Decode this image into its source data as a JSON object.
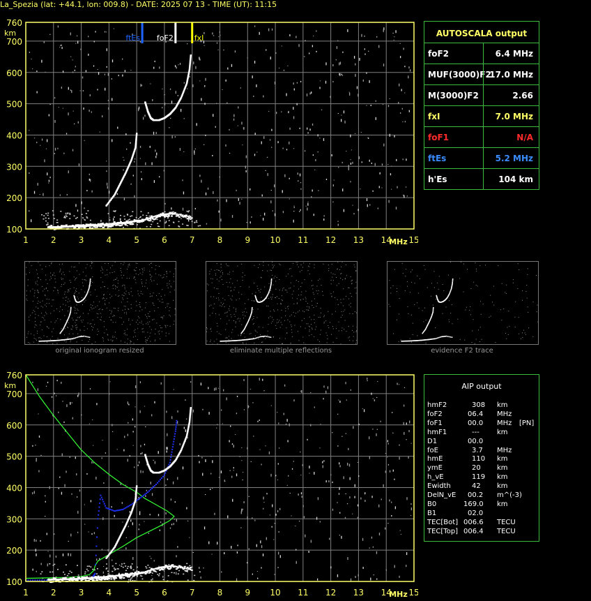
{
  "header": {
    "text": "La_Spezia (lat: +44.1, lon: 009.8) - DATE: 2025 07 13 - TIME (UT): 11:15"
  },
  "ionogram_top": {
    "y_unit": "km",
    "x_unit": "MHz",
    "x_ticks": [
      "1",
      "2",
      "3",
      "4",
      "5",
      "6",
      "7",
      "8",
      "9",
      "10",
      "11",
      "12",
      "13",
      "14",
      "15"
    ],
    "y_ticks": [
      "100",
      "200",
      "300",
      "400",
      "500",
      "600",
      "700",
      "760"
    ],
    "markers": {
      "ftEs": "ftEs",
      "foF2": "foF2",
      "fxI": "fxI"
    }
  },
  "ionogram_bottom": {
    "y_unit": "km",
    "x_unit": "MHz",
    "x_ticks": [
      "1",
      "2",
      "3",
      "4",
      "5",
      "6",
      "7",
      "8",
      "9",
      "10",
      "11",
      "12",
      "13",
      "14",
      "15"
    ],
    "y_ticks": [
      "100",
      "200",
      "300",
      "400",
      "500",
      "600",
      "700",
      "760"
    ]
  },
  "autoscala": {
    "title": "AUTOSCALA output",
    "rows": [
      {
        "label": "foF2",
        "value": "6.4 MHz",
        "color": "#ffffff"
      },
      {
        "label": "MUF(3000)F2",
        "value": "17.0 MHz",
        "color": "#ffffff"
      },
      {
        "label": "M(3000)F2",
        "value": "2.66",
        "color": "#ffffff"
      },
      {
        "label": "fxI",
        "value": "7.0 MHz",
        "color": "#ffff66"
      },
      {
        "label": "foF1",
        "value": "N/A",
        "color": "#ff2a2a"
      },
      {
        "label": "ftEs",
        "value": "5.2 MHz",
        "color": "#3a8cff"
      },
      {
        "label": "h'Es",
        "value": "104    km",
        "color": "#ffffff"
      }
    ]
  },
  "thumbnails": [
    {
      "caption": "original ionogram resized"
    },
    {
      "caption": "eliminate multiple reflections"
    },
    {
      "caption": "evidence F2 trace"
    }
  ],
  "aip": {
    "title": "AIP output",
    "rows": [
      {
        "param": "hmF2",
        "value": "308",
        "unit": "km",
        "extra": ""
      },
      {
        "param": "foF2",
        "value": "06.4",
        "unit": "MHz",
        "extra": ""
      },
      {
        "param": "foF1",
        "value": "00.0",
        "unit": "MHz",
        "extra": "[PN]"
      },
      {
        "param": "hmF1",
        "value": "---",
        "unit": "km",
        "extra": ""
      },
      {
        "param": "D1",
        "value": "00.0",
        "unit": "",
        "extra": ""
      },
      {
        "param": "foE",
        "value": "3.7",
        "unit": "MHz",
        "extra": ""
      },
      {
        "param": "hmE",
        "value": "110",
        "unit": "km",
        "extra": ""
      },
      {
        "param": "ymE",
        "value": "20",
        "unit": "km",
        "extra": ""
      },
      {
        "param": "h_vE",
        "value": "119",
        "unit": "km",
        "extra": ""
      },
      {
        "param": "Ewidth",
        "value": "42",
        "unit": "km",
        "extra": ""
      },
      {
        "param": "DelN_vE",
        "value": "00.2",
        "unit": "m^(-3)",
        "extra": ""
      },
      {
        "param": "B0",
        "value": "169.0",
        "unit": "km",
        "extra": ""
      },
      {
        "param": "B1",
        "value": "02.0",
        "unit": "",
        "extra": ""
      },
      {
        "param": "TEC[Bot]",
        "value": "006.6",
        "unit": "TECU",
        "extra": ""
      },
      {
        "param": "TEC[Top]",
        "value": "006.4",
        "unit": "TECU",
        "extra": ""
      }
    ]
  },
  "chart_data": [
    {
      "type": "scatter",
      "xlim": [
        1,
        15
      ],
      "ylim": [
        100,
        760
      ],
      "xlabel": "MHz",
      "ylabel": "km",
      "grid": true,
      "colors": {
        "axis": "#ffff66",
        "grid": "#808080",
        "trace": "#ffffff",
        "ftEs": "#1e64ff",
        "foF2": "#ffffff",
        "fxI": "#ffff00"
      },
      "vertical_markers": [
        {
          "name": "ftEs",
          "x": 5.2
        },
        {
          "name": "foF2",
          "x": 6.4
        },
        {
          "name": "fxI",
          "x": 7.0
        }
      ],
      "series": [
        {
          "points": [
            [
              1.8,
              106
            ],
            [
              2.2,
              107
            ],
            [
              2.6,
              108
            ],
            [
              3.0,
              110
            ],
            [
              3.3,
              111
            ],
            [
              3.6,
              113
            ],
            [
              3.9,
              115
            ],
            [
              4.2,
              118
            ],
            [
              4.5,
              120
            ],
            [
              4.8,
              124
            ],
            [
              5.2,
              128
            ],
            [
              5.8,
              145
            ],
            [
              6.3,
              150
            ],
            [
              7.0,
              138
            ]
          ]
        },
        {
          "points": [
            [
              3.9,
              175
            ],
            [
              4.2,
              210
            ],
            [
              4.4,
              245
            ],
            [
              4.6,
              280
            ],
            [
              4.8,
              320
            ],
            [
              4.95,
              360
            ],
            [
              5.0,
              410
            ]
          ]
        },
        {
          "points": [
            [
              5.3,
              505
            ],
            [
              5.4,
              475
            ],
            [
              5.5,
              455
            ],
            [
              5.6,
              448
            ],
            [
              5.8,
              448
            ],
            [
              6.0,
              455
            ],
            [
              6.2,
              468
            ],
            [
              6.4,
              488
            ],
            [
              6.6,
              520
            ],
            [
              6.8,
              565
            ],
            [
              6.9,
              610
            ],
            [
              6.95,
              660
            ]
          ]
        }
      ]
    },
    {
      "type": "line",
      "xlim": [
        1,
        15
      ],
      "ylim": [
        100,
        760
      ],
      "xlabel": "MHz",
      "ylabel": "km",
      "grid": true,
      "colors": {
        "axis": "#ffff66",
        "grid": "#808080",
        "profile": "#33ff33",
        "true_height": "#1e32ff",
        "trace": "#ffffff"
      },
      "series": [
        {
          "points": [
            [
              1.0,
              760
            ],
            [
              1.5,
              690
            ],
            [
              2.0,
              630
            ],
            [
              2.5,
              575
            ],
            [
              3.0,
              520
            ],
            [
              3.5,
              478
            ],
            [
              4.0,
              442
            ],
            [
              4.5,
              410
            ],
            [
              5.0,
              385
            ],
            [
              5.3,
              365
            ],
            [
              5.6,
              350
            ],
            [
              5.9,
              335
            ],
            [
              6.1,
              325
            ],
            [
              6.25,
              315
            ],
            [
              6.35,
              308
            ],
            [
              6.2,
              295
            ],
            [
              5.9,
              280
            ],
            [
              5.5,
              262
            ],
            [
              5.0,
              240
            ],
            [
              4.5,
              212
            ],
            [
              4.0,
              186
            ],
            [
              3.6,
              165
            ],
            [
              3.5,
              150
            ],
            [
              3.45,
              135
            ],
            [
              3.3,
              122
            ],
            [
              3.0,
              116
            ],
            [
              2.5,
              113
            ],
            [
              2.0,
              112
            ],
            [
              1.5,
              111
            ],
            [
              1.0,
              110
            ]
          ]
        },
        {
          "points": [
            [
              1.0,
              104
            ],
            [
              1.5,
              104
            ],
            [
              2.0,
              105
            ],
            [
              2.5,
              106
            ],
            [
              3.0,
              108
            ],
            [
              3.4,
              112
            ],
            [
              3.5,
              125
            ],
            [
              3.6,
              300
            ],
            [
              3.7,
              375
            ],
            [
              3.9,
              335
            ],
            [
              4.2,
              325
            ],
            [
              4.5,
              330
            ],
            [
              4.8,
              345
            ],
            [
              5.1,
              365
            ],
            [
              5.4,
              385
            ],
            [
              5.7,
              410
            ],
            [
              6.0,
              440
            ],
            [
              6.2,
              480
            ],
            [
              6.3,
              530
            ],
            [
              6.4,
              580
            ],
            [
              6.45,
              620
            ]
          ]
        },
        {
          "points": [
            [
              1.8,
              106
            ],
            [
              2.2,
              107
            ],
            [
              2.6,
              108
            ],
            [
              3.0,
              110
            ],
            [
              3.3,
              111
            ],
            [
              3.6,
              113
            ],
            [
              3.9,
              115
            ],
            [
              4.2,
              118
            ],
            [
              4.5,
              120
            ],
            [
              4.8,
              124
            ],
            [
              5.2,
              128
            ],
            [
              5.8,
              145
            ],
            [
              6.3,
              150
            ],
            [
              7.0,
              138
            ]
          ]
        },
        {
          "points": [
            [
              3.9,
              175
            ],
            [
              4.2,
              210
            ],
            [
              4.4,
              245
            ],
            [
              4.6,
              280
            ],
            [
              4.8,
              320
            ],
            [
              4.95,
              360
            ],
            [
              5.0,
              410
            ]
          ]
        },
        {
          "points": [
            [
              5.3,
              505
            ],
            [
              5.4,
              475
            ],
            [
              5.5,
              455
            ],
            [
              5.6,
              448
            ],
            [
              5.8,
              448
            ],
            [
              6.0,
              455
            ],
            [
              6.2,
              468
            ],
            [
              6.4,
              488
            ],
            [
              6.6,
              520
            ],
            [
              6.8,
              565
            ],
            [
              6.9,
              610
            ],
            [
              6.95,
              660
            ]
          ]
        }
      ]
    }
  ]
}
